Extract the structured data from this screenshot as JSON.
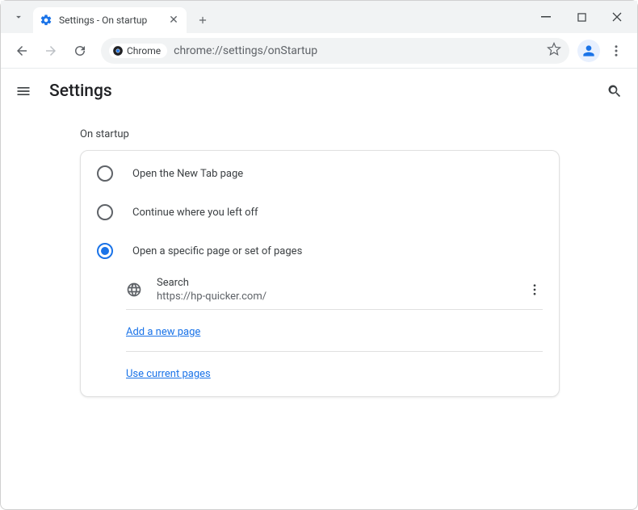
{
  "window": {
    "tab_title": "Settings - On startup"
  },
  "toolbar": {
    "chrome_chip": "Chrome",
    "url": "chrome://settings/onStartup"
  },
  "header": {
    "title": "Settings"
  },
  "section": {
    "label": "On startup",
    "options": [
      {
        "label": "Open the New Tab page",
        "checked": false
      },
      {
        "label": "Continue where you left off",
        "checked": false
      },
      {
        "label": "Open a specific page or set of pages",
        "checked": true
      }
    ],
    "pages": [
      {
        "title": "Search",
        "url": "https://hp-quicker.com/"
      }
    ],
    "add_link": "Add a new page",
    "use_current_link": "Use current pages"
  }
}
